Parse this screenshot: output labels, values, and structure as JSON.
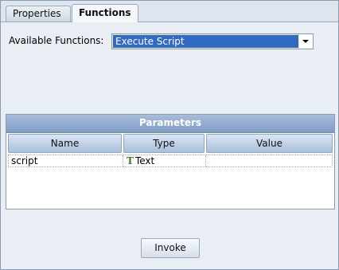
{
  "tabs": [
    {
      "label": "Properties",
      "active": false
    },
    {
      "label": "Functions",
      "active": true
    }
  ],
  "functions": {
    "label": "Available Functions:",
    "selected": "Execute Script"
  },
  "parameters": {
    "title": "Parameters",
    "columns": [
      "Name",
      "Type",
      "Value"
    ],
    "rows": [
      {
        "name": "script",
        "type": "Text",
        "type_icon": "text-type-icon",
        "value": ""
      }
    ]
  },
  "invoke_label": "Invoke",
  "colors": {
    "selection": "#316ac5",
    "header_blue": "#7f9cc4",
    "text_icon_green": "#3d7a1f"
  }
}
